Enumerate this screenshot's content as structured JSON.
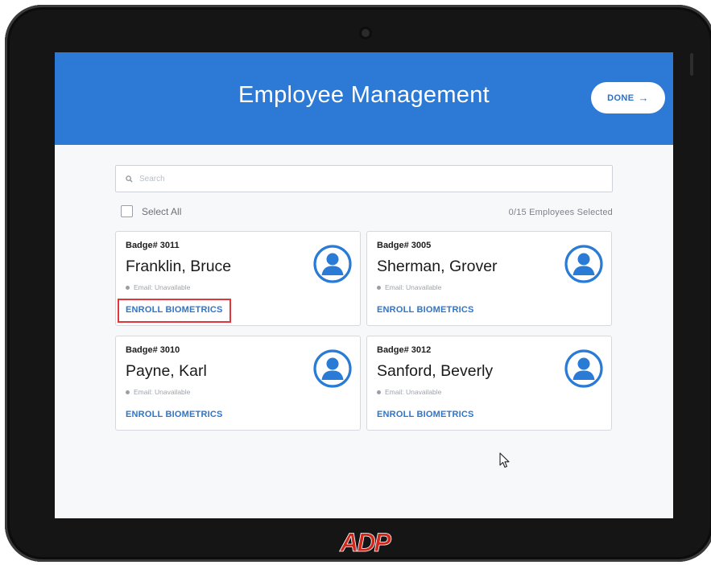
{
  "header": {
    "title": "Employee Management",
    "done_label": "DONE",
    "done_icon": "arrow-right-icon"
  },
  "search": {
    "placeholder": "Search",
    "value": "",
    "icon": "search-icon"
  },
  "selection": {
    "select_all_label": "Select All",
    "select_all_checked": false,
    "count_text": "0/15 Employees Selected"
  },
  "employees": [
    {
      "badge": "Badge# 3011",
      "name": "Franklin, Bruce",
      "email": "Email: Unavailable",
      "action": "ENROLL BIOMETRICS",
      "highlighted": true
    },
    {
      "badge": "Badge# 3005",
      "name": "Sherman, Grover",
      "email": "Email: Unavailable",
      "action": "ENROLL BIOMETRICS",
      "highlighted": false
    },
    {
      "badge": "Badge# 3010",
      "name": "Payne, Karl",
      "email": "Email: Unavailable",
      "action": "ENROLL BIOMETRICS",
      "highlighted": false
    },
    {
      "badge": "Badge# 3012",
      "name": "Sanford, Beverly",
      "email": "Email: Unavailable",
      "action": "ENROLL BIOMETRICS",
      "highlighted": false
    }
  ],
  "brand": {
    "logo_text": "ADP",
    "logo_color": "#d0271d"
  },
  "colors": {
    "header_blue": "#2d7ad6",
    "link_blue": "#2f75c8",
    "highlight_red": "#e0363c"
  }
}
